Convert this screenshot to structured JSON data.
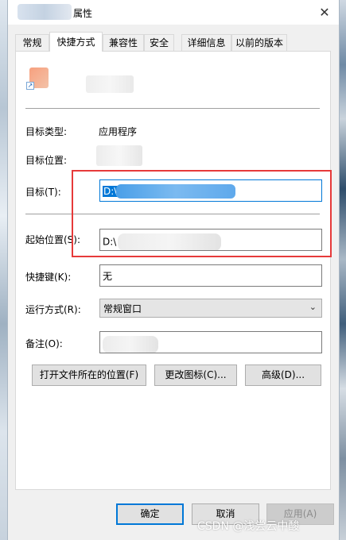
{
  "window": {
    "title": "属性",
    "close_glyph": "✕"
  },
  "tabs": [
    "常规",
    "快捷方式",
    "兼容性",
    "安全",
    "详细信息",
    "以前的版本"
  ],
  "active_tab": "快捷方式",
  "properties": {
    "target_type_label": "目标类型:",
    "target_type_value": "应用程序",
    "target_location_label": "目标位置:",
    "target_label": "目标(T):",
    "target_value": "D:\\",
    "start_in_label": "起始位置(S):",
    "start_in_value": "D:\\",
    "shortcut_key_label": "快捷键(K):",
    "shortcut_key_value": "无",
    "run_label": "运行方式(R):",
    "run_value": "常规窗口",
    "comment_label": "备注(O):"
  },
  "action_buttons": {
    "open_location": "打开文件所在的位置(F)",
    "change_icon": "更改图标(C)...",
    "advanced": "高级(D)..."
  },
  "footer": {
    "ok": "确定",
    "cancel": "取消",
    "apply": "应用(A)"
  },
  "watermark": "CSDN @浅尝云中酸",
  "colors": {
    "accent": "#0078d7",
    "highlight_box": "#e63a3a"
  }
}
